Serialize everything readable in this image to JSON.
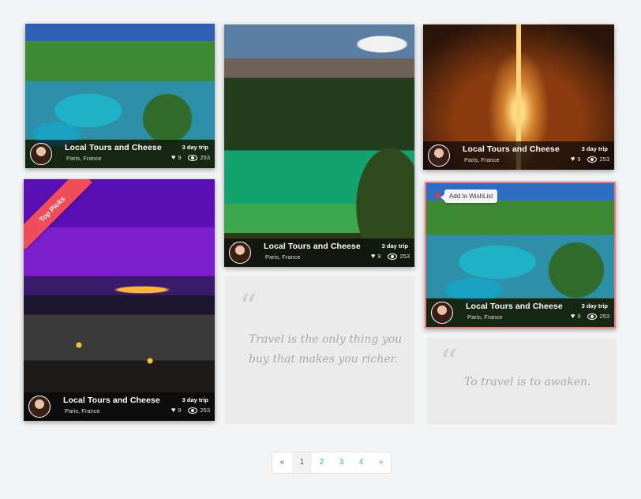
{
  "cards": [
    {
      "title": "Local Tours and Cheese",
      "location": "Paris, France",
      "duration": "3 day trip",
      "likes": "9",
      "views": "253"
    },
    {
      "title": "Local Tours and Cheese",
      "location": "Paris, France",
      "duration": "3 day trip",
      "likes": "9",
      "views": "253"
    },
    {
      "title": "Local Tours and Cheese",
      "location": "Paris, France",
      "duration": "3 day trip",
      "likes": "9",
      "views": "253"
    },
    {
      "title": "Local Tours and Cheese",
      "location": "Paris, France",
      "duration": "3 day trip",
      "likes": "9",
      "views": "253"
    },
    {
      "title": "Local Tours and Cheese",
      "location": "Paris, France",
      "duration": "3 day trip",
      "likes": "9",
      "views": "253"
    }
  ],
  "ribbon": {
    "label": "Top Picks"
  },
  "wishlist": {
    "label": "Add to WishList"
  },
  "quotes": [
    {
      "mark": "“",
      "text1": "Travel is the only thing you",
      "text2": "buy that makes you richer."
    },
    {
      "mark": "“",
      "text1": "To travel is to awaken."
    }
  ],
  "pagination": {
    "prev": "«",
    "pages": [
      "1",
      "2",
      "3",
      "4"
    ],
    "next": "»",
    "active": "1"
  },
  "colors": {
    "ribbon": "#ef4d57",
    "link": "#39a8d8",
    "hover_border": "#f07a7a"
  }
}
